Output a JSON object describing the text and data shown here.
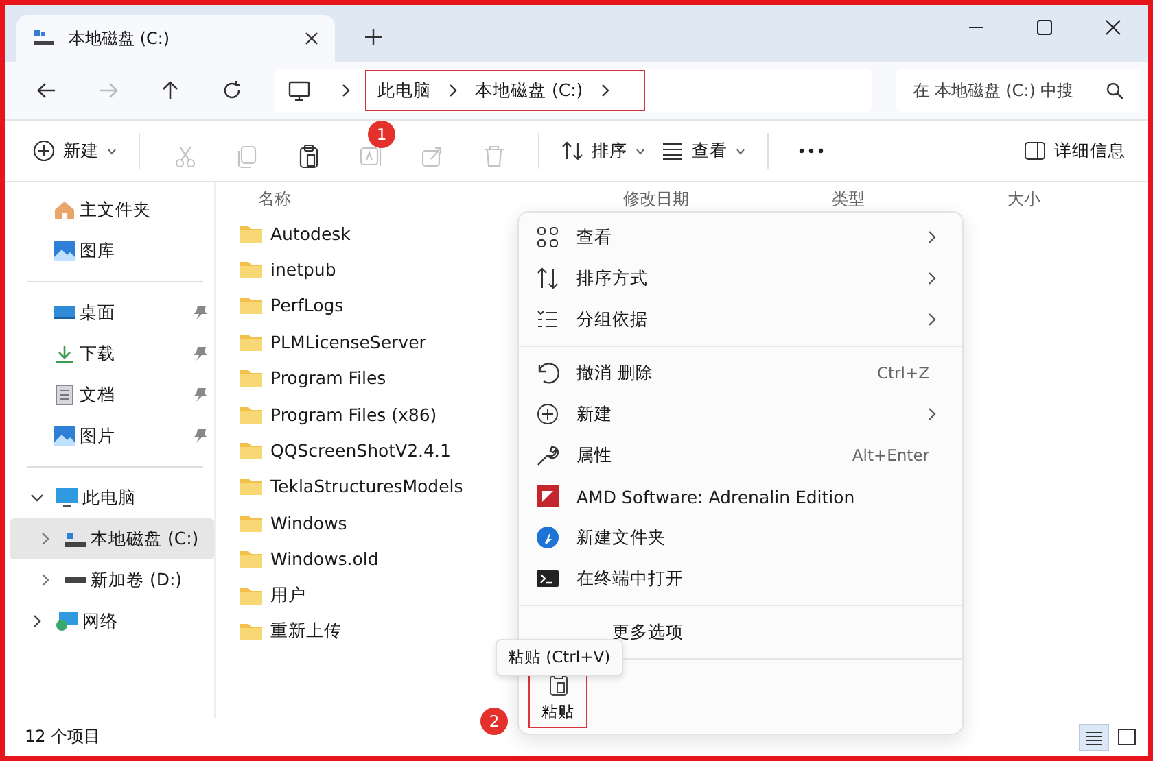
{
  "window": {
    "tab_title": "本地磁盘 (C:)"
  },
  "address": {
    "crumbs": [
      "此电脑",
      "本地磁盘 (C:)"
    ]
  },
  "search": {
    "placeholder": "在 本地磁盘 (C:) 中搜"
  },
  "toolbar": {
    "new": "新建",
    "actions": [
      {
        "disabled": true
      },
      {
        "disabled": true
      },
      {
        "disabled": false
      },
      {
        "disabled": true
      },
      {
        "disabled": true
      },
      {
        "disabled": true
      }
    ],
    "sort": "排序",
    "view": "查看",
    "details": "详细信息"
  },
  "sidebar": {
    "sections": [
      [
        {
          "label": "主文件夹",
          "pinned": false,
          "selected": false
        },
        {
          "label": "图库",
          "pinned": false,
          "selected": false
        }
      ],
      [
        {
          "label": "桌面",
          "pinned": true,
          "selected": false
        },
        {
          "label": "下载",
          "pinned": true,
          "selected": false
        },
        {
          "label": "文档",
          "pinned": true,
          "selected": false
        },
        {
          "label": "图片",
          "pinned": true,
          "selected": false
        }
      ],
      [
        {
          "label": "此电脑",
          "selected": false,
          "expanded": true,
          "children": [
            {
              "label": "本地磁盘 (C:)",
              "selected": true,
              "expanded": false
            },
            {
              "label": "新加卷 (D:)",
              "selected": false,
              "expanded": false
            }
          ]
        },
        {
          "label": "网络",
          "selected": false,
          "expanded": false
        }
      ]
    ]
  },
  "files": {
    "columns": [
      "名称",
      "修改日期",
      "类型",
      "大小"
    ],
    "rows": [
      "Autodesk",
      "inetpub",
      "PerfLogs",
      "PLMLicenseServer",
      "Program Files",
      "Program Files (x86)",
      "QQScreenShotV2.4.1",
      "TeklaStructuresModels",
      "Windows",
      "Windows.old",
      "用户",
      "重新上传"
    ]
  },
  "context_menu": {
    "sections": [
      [
        {
          "kind": "option",
          "label": "查看",
          "submenu": true
        },
        {
          "kind": "option",
          "label": "排序方式",
          "submenu": true
        },
        {
          "kind": "option",
          "label": "分组依据",
          "submenu": true
        }
      ],
      [
        {
          "kind": "option",
          "label": "撤消 删除",
          "shortcut": "Ctrl+Z",
          "submenu": false
        },
        {
          "kind": "option",
          "label": "新建",
          "submenu": true
        },
        {
          "kind": "option",
          "label": "属性",
          "shortcut": "Alt+Enter",
          "submenu": false
        },
        {
          "kind": "option",
          "label": "AMD Software: Adrenalin Edition",
          "submenu": false
        },
        {
          "kind": "option",
          "label": "新建文件夹",
          "submenu": false
        },
        {
          "kind": "option",
          "label": "在终端中打开",
          "submenu": false
        }
      ],
      [
        {
          "kind": "covered",
          "label": "更多选项",
          "submenu": false
        }
      ]
    ],
    "paste": "粘贴"
  },
  "tooltip": "粘贴 (Ctrl+V)",
  "status": "12 个项目",
  "view_modes": [
    {
      "selected": true
    },
    {
      "selected": false
    }
  ],
  "annotations": [
    "1",
    "2"
  ]
}
